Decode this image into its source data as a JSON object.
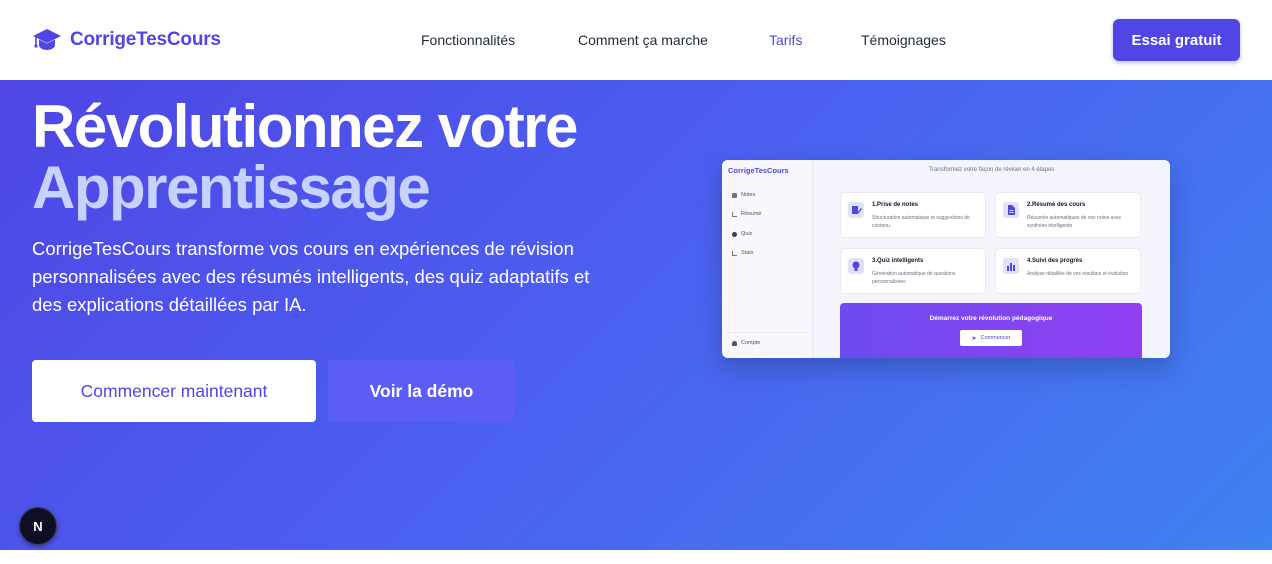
{
  "brand": {
    "name": "CorrigeTesCours",
    "icon": "graduation-cap-icon"
  },
  "nav": {
    "links": [
      "Fonctionnalités",
      "Comment ça marche",
      "Tarifs",
      "Témoignages"
    ],
    "active": "Tarifs",
    "cta": "Essai gratuit"
  },
  "hero": {
    "title_line1": "Révolutionnez votre",
    "title_line2": "Apprentissage",
    "lead": "CorrigeTesCours transforme vos cours en expériences de révision personnalisées avec des résumés intelligents, des quiz adaptatifs et des explications détaillées par IA.",
    "primary_cta": "Commencer maintenant",
    "secondary_cta": "Voir la démo"
  },
  "mockup": {
    "brand": "CorrigeTesCours",
    "sidebar": [
      "Notes",
      "Résumé",
      "Quiz",
      "Stats"
    ],
    "account": "Compte",
    "title": "Transformez votre façon de réviser en 4 étapes",
    "cards": [
      {
        "title": "1.Prise de notes",
        "desc": "Structuration automatique et suggestions de contenu",
        "icon": "note-edit-icon"
      },
      {
        "title": "2.Résumé des cours",
        "desc": "Résumés automatiques de vos notes avec synthèse intelligente",
        "icon": "document-icon"
      },
      {
        "title": "3.Quiz intelligents",
        "desc": "Génération automatique de questions personnalisées",
        "icon": "lightbulb-icon"
      },
      {
        "title": "4.Suivi des progrès",
        "desc": "Analyse détaillée de vos résultats et évolution",
        "icon": "bar-chart-icon"
      }
    ],
    "cta_title": "Démarrez votre révolution pédagogique",
    "cta_button": "Commencer"
  },
  "badge": {
    "letter": "N"
  },
  "colors": {
    "accent": "#4f46e5",
    "hero_from": "#4f46e5",
    "hero_to": "#3f82f0",
    "title_light": "#c7d2fe",
    "demo_button": "#5c5cf7"
  }
}
